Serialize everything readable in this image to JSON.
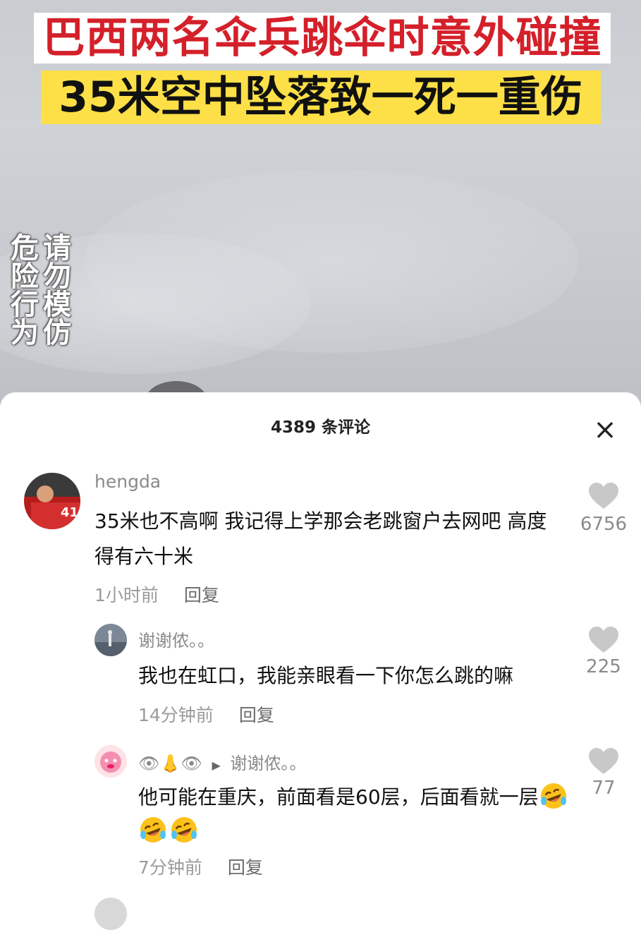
{
  "video": {
    "headline_line1": "巴西两名伞兵跳伞时意外碰撞",
    "headline_line2": "35米空中坠落致一死一重伤",
    "warning_right": "请勿模仿",
    "warning_left": "危险行为"
  },
  "comments_panel": {
    "title": "4389 条评论",
    "close_icon": "close-icon",
    "comments": [
      {
        "username": "hengda",
        "text": "35米也不高啊 我记得上学那会老跳窗户去网吧 高度得有六十米",
        "time": "1小时前",
        "reply_label": "回复",
        "likes": "6756"
      },
      {
        "username": "谢谢侬。。",
        "text": "我也在虹口，我能亲眼看一下你怎么跳的嘛",
        "time": "14分钟前",
        "reply_label": "回复",
        "likes": "225"
      },
      {
        "username": "👁👃👁",
        "reply_arrow": "▶",
        "reply_to": "谢谢侬。。",
        "text": "他可能在重庆，前面看是60层，后面看就一层",
        "emojis": [
          "rofl-emoji",
          "rofl-emoji",
          "rofl-emoji"
        ],
        "time": "7分钟前",
        "reply_label": "回复",
        "likes": "77"
      }
    ]
  },
  "colors": {
    "headline_red": "#d4202a",
    "headline_yellow_bg": "#fde047",
    "meta_gray": "#9b9b9b",
    "heart_gray": "#c8c8c8"
  }
}
